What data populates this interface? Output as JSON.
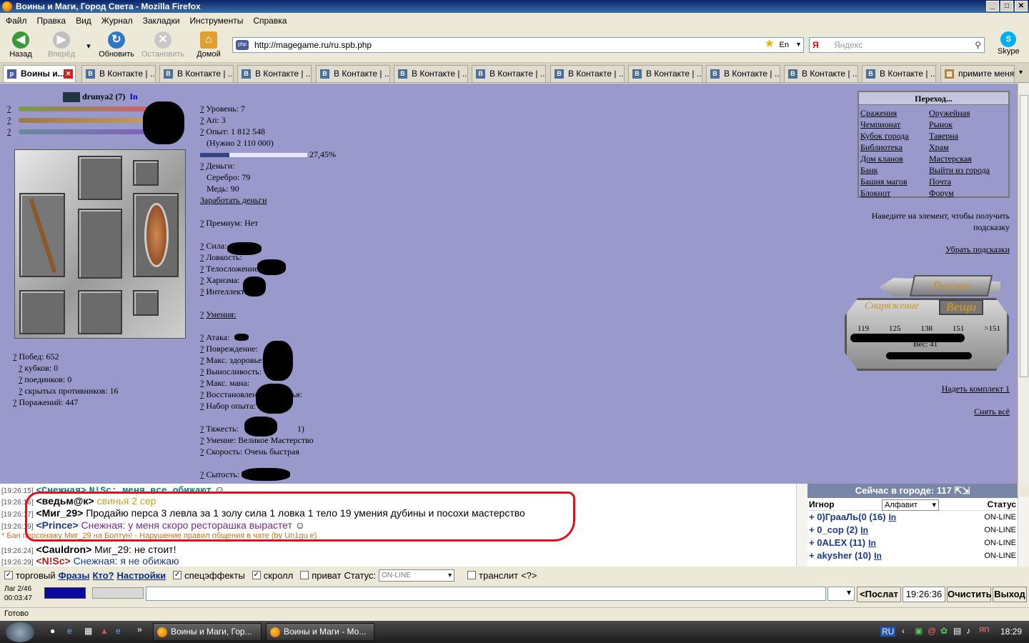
{
  "window": {
    "title": "Воины и Маги, Город Света - Mozilla Firefox"
  },
  "menu": [
    "Файл",
    "Правка",
    "Вид",
    "Журнал",
    "Закладки",
    "Инструменты",
    "Справка"
  ],
  "toolbar": {
    "back": "Назад",
    "forward": "Вперёд",
    "reload": "Обновить",
    "stop": "Остановить",
    "home": "Домой",
    "url": "http://magegame.ru/ru.spb.php",
    "lang": "En",
    "search_placeholder": "Яндекс",
    "search_logo": "Я",
    "skype": "Skype"
  },
  "tabs": {
    "active": "Воины и...",
    "vk": "В Контакте | ...",
    "last": "примите меня!"
  },
  "character": {
    "name": "drunya2",
    "level_badge": "(7)",
    "in_link": "In",
    "wins": "Побед: 652",
    "cups": "кубков: 0",
    "duels": "поединков: 0",
    "hidden": "скрытых противников: 16",
    "losses": "Поражений: 447",
    "level": "Уровень: 7",
    "ap": "Ап: 3",
    "exp": "Опыт: 1 812 548",
    "exp_need": "(Нужно 2 110 000)",
    "exp_percent_text": "27,45%",
    "exp_fraction": 0.2745,
    "money": "Деньги:",
    "silver": "Серебро: 79",
    "copper": "Медь: 90",
    "earn": "Заработать деньги",
    "premium": "Премиум: Нет",
    "strength": "Сила:",
    "agility": "Ловкость:",
    "constitution": "Телосложение:",
    "charisma": "Харизма:",
    "intellect": "Интеллект:",
    "skills": "Умения:",
    "attack": "Атака:",
    "damage": "Повреждение:",
    "max_health": "Макс. здоровье:",
    "endurance": "Выносливость:",
    "max_mana": "Макс. мана:",
    "health_regen": "Восстановление здоровья:",
    "exp_gain": "Набор опыта:",
    "weight": "Тяжесть:",
    "weight_tail": "1)",
    "skill_line": "Умение: Великое Мастерство",
    "speed": "Скорость: Очень быстрая",
    "satiety": "Сытость:"
  },
  "navigation": {
    "header": "Переход...",
    "left": [
      "Сражения",
      "Чемпионат",
      "Кубок города",
      "Библиотека",
      "Дом кланов",
      "Банк",
      "Башня магов",
      "Блокнот"
    ],
    "right": [
      "Оружейная",
      "Рынок",
      "Таверна",
      "Храм",
      "Мастерская",
      "Выйти из города",
      "Почта",
      "Форум"
    ]
  },
  "hint": {
    "text": "Наведите на элемент, чтобы получить подсказку",
    "hide": "Убрать подсказки"
  },
  "backpack": {
    "title": "Рюкзак",
    "tab_equipment": "Снаряжение",
    "tab_items": "Вещи",
    "nums": [
      "119",
      "125",
      "138",
      "151",
      ">151"
    ],
    "weight": "Вес: 41",
    "wear_set": "Надеть комплект 1",
    "unequip_all": "Снять всё"
  },
  "chat": {
    "lines": [
      {
        "time": "[19:26:15]",
        "nick": "<Снежная>",
        "text": "N!Sc: меня все обижают"
      },
      {
        "time": "[19:26:16]",
        "nick": "<ведьм@к>",
        "text": "свинья 2 сер"
      },
      {
        "time": "[19:26:17]",
        "nick": "<Миг_29>",
        "text": "Продайю перса 3 левла за 1 золу сила 1 ловка 1 тело 19 умения дубины и посохи мастерство"
      },
      {
        "time": "[19:26:19]",
        "nick": "<Prince>",
        "text": "Снежная: у меня скоро ресторашка вырастет"
      },
      {
        "time": "",
        "nick": "",
        "text": "* Бан персонажу Миг_29 на Болтун! - Нарушение правил общения в чате (by Un1gu e)"
      },
      {
        "time": "[19:26:24]",
        "nick": "<Cauldron>",
        "text": "Миг_29: не стоит!"
      },
      {
        "time": "[19:26:29]",
        "nick": "<N!Sc>",
        "text": "Снежная: я не обижаю"
      }
    ]
  },
  "users": {
    "header": "Сейчас в городе: 117",
    "ignore": "Игнор",
    "sort": "Алфавит",
    "status_col": "Статус",
    "list": [
      {
        "name": "0)ГрааЛь(0 (16)",
        "in": "In",
        "status": "ON-LINE"
      },
      {
        "name": "0_cop (2)",
        "in": "In",
        "status": "ON-LINE"
      },
      {
        "name": "0ALEX (11)",
        "in": "In",
        "status": "ON-LINE"
      },
      {
        "name": "akysher (10)",
        "in": "In",
        "status": "ON-LINE"
      }
    ]
  },
  "options": {
    "trade": "торговый",
    "phrases": "Фразы",
    "who": "Кто?",
    "settings": "Настройки",
    "effects": "спецэффекты",
    "scroll": "скролл",
    "private": "приват",
    "status_label": "Статус:",
    "status_value": "ON-LINE",
    "translit": "транслит",
    "translit_q": "<?>"
  },
  "input": {
    "lag": "Лаг 2/46",
    "elapsed": "00:03:47",
    "send": "<Послат",
    "time": "19:26:36",
    "clear": "Очистить",
    "exit": "Выход"
  },
  "status_bar": "Готово",
  "taskbar": {
    "task1": "Воины и Маги, Гор...",
    "task2": "Воины и Маги - Мо...",
    "lang": "RU",
    "clock": "18:29"
  },
  "colors": {
    "page_bg": "#9999cc",
    "chat_cyan": "#0b7a7a",
    "red_annotation": "#e01020"
  }
}
